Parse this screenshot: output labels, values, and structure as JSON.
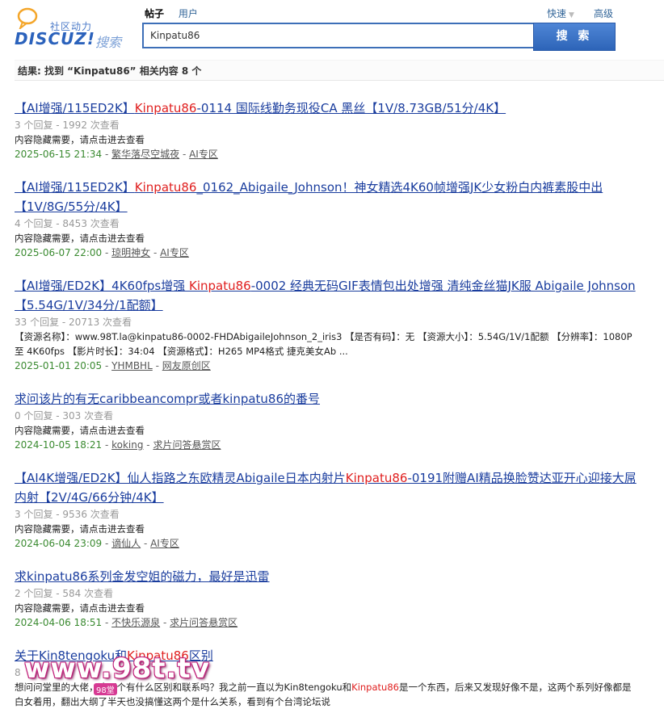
{
  "logo": {
    "small_text": "社区动力",
    "main_text": "DISCUZ!",
    "sub_text": "搜索"
  },
  "tabs": [
    {
      "label": "帖子",
      "active": true
    },
    {
      "label": "用户",
      "active": false
    }
  ],
  "header_links": {
    "quick": "快速",
    "advanced": "高级"
  },
  "search": {
    "value": "Kinpatu86",
    "button_label": "搜 索"
  },
  "summary": "结果: 找到 “Kinpatu86” 相关内容 8 个",
  "results": [
    {
      "title_pre": "【AI增强/115ED2K】",
      "title_hl": "Kinpatu86",
      "title_post": "-0114 国际线勤务现役CA 黑丝【1V/8.73GB/51分/4K】",
      "meta": "3 个回复 - 1992 次查看",
      "desc": "内容隐藏需要，请点击进去查看",
      "date": "2025-06-15 21:34",
      "author": "繁华落尽空城夜",
      "forum": "AI专区"
    },
    {
      "title_pre": "【AI增强/115ED2K】",
      "title_hl": "Kinpatu86",
      "title_post": "_0162_Abigaile_Johnson！神女精选4K60帧增强JK少女粉白内裤素股中出【1V/8G/55分/4K】",
      "meta": "4 个回复 - 8453 次查看",
      "desc": "内容隐藏需要，请点击进去查看",
      "date": "2025-06-07 22:00",
      "author": "琼明神女",
      "forum": "AI专区"
    },
    {
      "title_pre": "【AI增强/ED2K】4K60fps增强 ",
      "title_hl": "Kinpatu86",
      "title_post": "-0002 经典无码GIF表情包出处增强 清纯金丝猫JK服 Abigaile Johnson 【5.54G/1V/34分/1配额】",
      "meta": "33 个回复 - 20713 次查看",
      "desc": "【资源名称】：www.98T.la@kinpatu86-0002-FHDAbigaileJohnson_2_iris3 【是否有码】：无 【资源大小】：5.54G/1V/1配额 【分辨率】：1080P 至 4K60fps 【影片时长】：34:04 【资源格式】：H265 MP4格式 捷克美女Ab ...",
      "date": "2025-01-01 20:05",
      "author": "YHMBHL",
      "forum": "网友原创区"
    },
    {
      "title_pre": "求问该片的有无caribbeancompr或者kinpatu86的番号",
      "title_hl": "",
      "title_post": "",
      "meta": "0 个回复 - 303 次查看",
      "desc": "内容隐藏需要，请点击进去查看",
      "date": "2024-10-05 18:21",
      "author": "koking",
      "forum": "求片问答悬赏区"
    },
    {
      "title_pre": "【AI4K增强/ED2K】仙人指路之东欧精灵Abigaile日本内射片",
      "title_hl": "Kinpatu86",
      "title_post": "-0191附赠AI精品换脸赞达亚开心迎接大屌内射【2V/4G/66分钟/4K】",
      "meta": "3 个回复 - 9536 次查看",
      "desc": "内容隐藏需要，请点击进去查看",
      "date": "2024-06-04 23:09",
      "author": "谪仙人",
      "forum": "AI专区"
    },
    {
      "title_pre": "求kinpatu86系列金发空姐的磁力，最好是迅雷",
      "title_hl": "",
      "title_post": "",
      "meta": "2 个回复 - 584 次查看",
      "desc": "内容隐藏需要，请点击进去查看",
      "date": "2024-04-06 18:51",
      "author": "不快乐源泉",
      "forum": "求片问答悬赏区"
    },
    {
      "title_pre": "关于Kin8tengoku和",
      "title_hl": "Kinpatu86",
      "title_post": "区别",
      "meta": "8",
      "desc_pre": "想问问堂里的大佬，这两个有什么区别和联系吗？我之前一直以为Kin8tengoku和",
      "desc_hl": "Kinpatu86",
      "desc_post": "是一个东西，后来又发现好像不是，这两个系列好像都是白女着用，翻出大纲了半天也没搞懂这两个是什么关系，看到有个台湾论坛说",
      "date": "",
      "author": "",
      "forum": ""
    }
  ],
  "watermark": {
    "text": "www.98t.tv",
    "sub": "98堂"
  }
}
